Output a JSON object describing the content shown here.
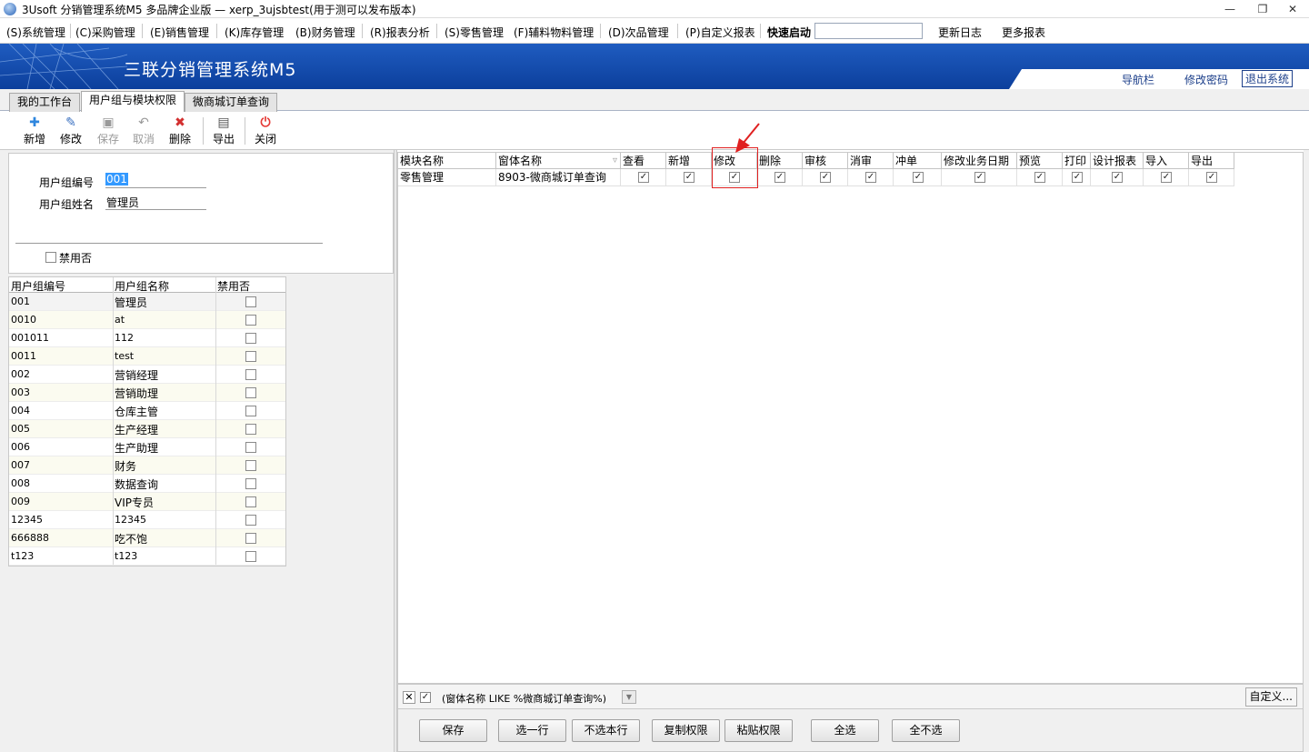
{
  "window": {
    "title": "3Usoft 分销管理系统M5 多品牌企业版 — xerp_3ujsbtest(用于测可以发布版本)",
    "controls": [
      "—",
      "❐",
      "✕"
    ]
  },
  "menu": {
    "items": [
      "(S)系统管理",
      "(C)采购管理",
      "(E)销售管理",
      "(K)库存管理",
      "(B)财务管理",
      "(R)报表分析",
      "(S)零售管理",
      "(F)辅料物料管理",
      "(D)次品管理",
      "(P)自定义报表"
    ],
    "quick_start_label": "快速启动",
    "quick_start_value": "",
    "update_log": "更新日志",
    "more_reports": "更多报表"
  },
  "banner": {
    "title": "三联分销管理系统M5",
    "links": [
      "导航栏",
      "修改密码",
      "退出系统"
    ]
  },
  "tabs": [
    "我的工作台",
    "用户组与模块权限",
    "微商城订单查询"
  ],
  "active_tab": "用户组与模块权限",
  "toolbar": {
    "new": "新增",
    "edit": "修改",
    "save": "保存",
    "cancel": "取消",
    "delete": "删除",
    "export": "导出",
    "close": "关闭"
  },
  "form": {
    "group_code_label": "用户组编号",
    "group_code_value": "001",
    "group_name_label": "用户组姓名",
    "group_name_value": "管理员",
    "disabled_label": "禁用否",
    "disabled_checked": false
  },
  "group_table": {
    "columns": [
      "用户组编号",
      "用户组名称",
      "禁用否"
    ],
    "rows": [
      {
        "code": "001",
        "name": "管理员",
        "disabled": false
      },
      {
        "code": "0010",
        "name": "at",
        "disabled": false
      },
      {
        "code": "001011",
        "name": "112",
        "disabled": false
      },
      {
        "code": "0011",
        "name": "test",
        "disabled": false
      },
      {
        "code": "002",
        "name": "营销经理",
        "disabled": false
      },
      {
        "code": "003",
        "name": "营销助理",
        "disabled": false
      },
      {
        "code": "004",
        "name": "仓库主管",
        "disabled": false
      },
      {
        "code": "005",
        "name": "生产经理",
        "disabled": false
      },
      {
        "code": "006",
        "name": "生产助理",
        "disabled": false
      },
      {
        "code": "007",
        "name": "财务",
        "disabled": false
      },
      {
        "code": "008",
        "name": "数据查询",
        "disabled": false
      },
      {
        "code": "009",
        "name": "VIP专员",
        "disabled": false
      },
      {
        "code": "12345",
        "name": "12345",
        "disabled": false
      },
      {
        "code": "666888",
        "name": "吃不饱",
        "disabled": false
      },
      {
        "code": "t123",
        "name": "t123",
        "disabled": false
      }
    ]
  },
  "permission_table": {
    "columns": [
      "模块名称",
      "窗体名称",
      "查看",
      "新增",
      "修改",
      "删除",
      "审核",
      "消审",
      "冲单",
      "修改业务日期",
      "预览",
      "打印",
      "设计报表",
      "导入",
      "导出"
    ],
    "rows": [
      {
        "module": "零售管理",
        "form": "8903-微商城订单查询",
        "perms": [
          true,
          true,
          true,
          true,
          true,
          true,
          true,
          true,
          true,
          true,
          true,
          true,
          true
        ]
      }
    ]
  },
  "filter": {
    "enabled": true,
    "text": "(窗体名称 LIKE %微商城订单查询%)",
    "customize": "自定义..."
  },
  "bottom_buttons": [
    "保存",
    "选一行",
    "不选本行",
    "复制权限",
    "粘贴权限",
    "全选",
    "全不选"
  ],
  "colors": {
    "banner": "#1a52b0",
    "highlight": "#e02020",
    "selection": "#3399ff"
  }
}
